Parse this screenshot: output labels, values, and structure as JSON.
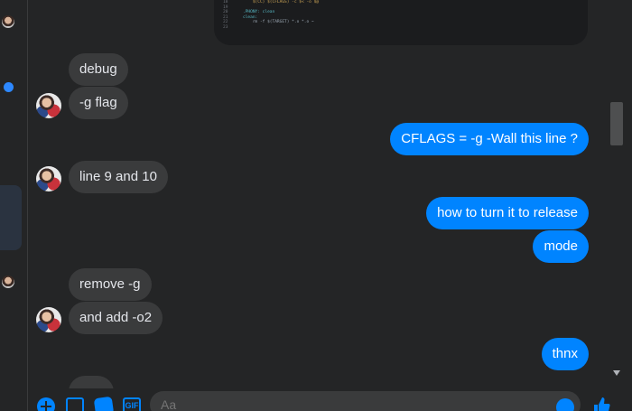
{
  "code_snippet": {
    "lines": [
      {
        "num": "18",
        "text": "    $(CC) $(CFLAGS) -c $< -o $@"
      },
      {
        "num": "19",
        "text": ""
      },
      {
        "num": "20",
        "text": ".PHONY: clean"
      },
      {
        "num": "21",
        "text": "clean:"
      },
      {
        "num": "22",
        "text": "    rm -f $(TARGET) *.o *.o ~"
      },
      {
        "num": "23",
        "text": ""
      }
    ]
  },
  "messages": [
    {
      "id": "m1",
      "text": "debug"
    },
    {
      "id": "m2",
      "text": "-g flag"
    },
    {
      "id": "m3",
      "text": "CFLAGS = -g -Wall this line ?"
    },
    {
      "id": "m4",
      "text": "line 9 and 10"
    },
    {
      "id": "m5",
      "text": "how to turn it to release"
    },
    {
      "id": "m6",
      "text": "mode"
    },
    {
      "id": "m7",
      "text": "remove -g"
    },
    {
      "id": "m8",
      "text": "and add -o2"
    },
    {
      "id": "m9",
      "text": "thnx"
    }
  ],
  "composer": {
    "placeholder": "Aa",
    "gif_label": "GIF",
    "icons": [
      "plus-icon",
      "image-icon",
      "sticker-icon",
      "gif-icon",
      "emoji-icon",
      "thumbs-up-icon"
    ]
  },
  "colors": {
    "incoming_bubble": "#3a3b3c",
    "outgoing_bubble": "#0084ff",
    "background": "#242526"
  }
}
